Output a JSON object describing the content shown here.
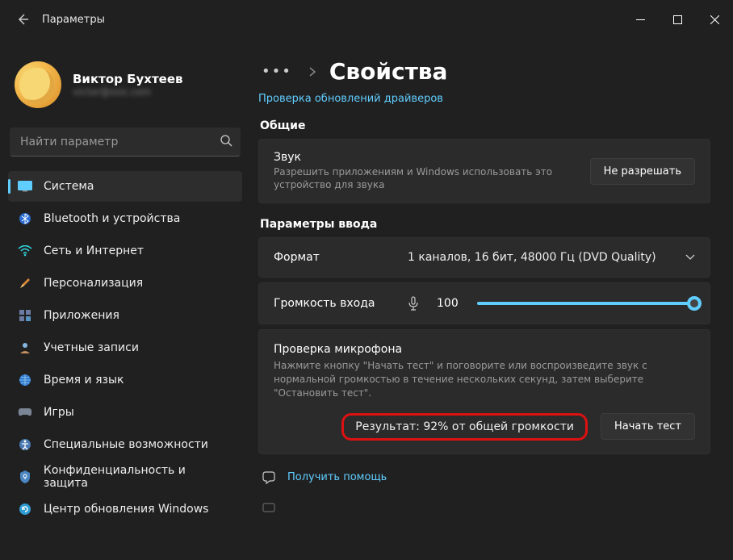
{
  "titlebar": {
    "title": "Параметры"
  },
  "profile": {
    "name": "Виктор Бухтеев",
    "email": "victor@xxx.com"
  },
  "search": {
    "placeholder": "Найти параметр"
  },
  "nav": {
    "items": [
      {
        "label": "Система"
      },
      {
        "label": "Bluetooth и устройства"
      },
      {
        "label": "Сеть и Интернет"
      },
      {
        "label": "Персонализация"
      },
      {
        "label": "Приложения"
      },
      {
        "label": "Учетные записи"
      },
      {
        "label": "Время и язык"
      },
      {
        "label": "Игры"
      },
      {
        "label": "Специальные возможности"
      },
      {
        "label": "Конфиденциальность и защита"
      },
      {
        "label": "Центр обновления Windows"
      }
    ]
  },
  "breadcrumb": {
    "title": "Свойства"
  },
  "driver_link": "Проверка обновлений драйверов",
  "sections": {
    "general": "Общие",
    "input": "Параметры ввода"
  },
  "sound_card": {
    "title": "Звук",
    "desc": "Разрешить приложениям и Windows использовать это устройство для звука",
    "btn": "Не разрешать"
  },
  "format": {
    "label": "Формат",
    "value": "1 каналов, 16 бит, 48000 Гц (DVD Quality)"
  },
  "volume": {
    "label": "Громкость входа",
    "value": "100"
  },
  "mic_test": {
    "title": "Проверка микрофона",
    "desc": "Нажмите кнопку \"Начать тест\" и поговорите или воспроизведите звук с нормальной громкостью в течение нескольких секунд, затем выберите \"Остановить тест\".",
    "result": "Результат: 92% от общей громкости",
    "btn": "Начать тест"
  },
  "help": {
    "label": "Получить помощь"
  }
}
